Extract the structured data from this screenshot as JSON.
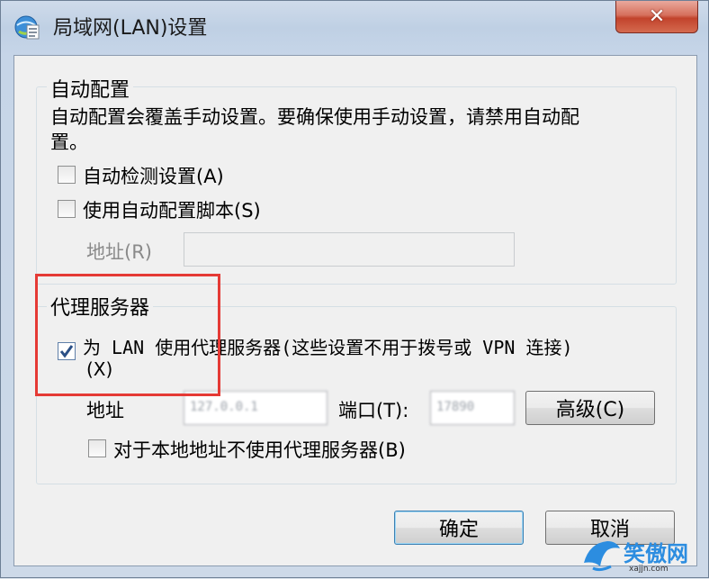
{
  "window": {
    "title": "局域网(LAN)设置",
    "close_label": "✕"
  },
  "auto_config": {
    "group_label": "自动配置",
    "description_line1": "自动配置会覆盖手动设置。要确保使用手动设置，请禁用自动配",
    "description_line2": "置。",
    "auto_detect_label": "自动检测设置(A)",
    "auto_detect_checked": false,
    "use_script_label": "使用自动配置脚本(S)",
    "use_script_checked": false,
    "address_label": "地址(R)",
    "address_value": ""
  },
  "proxy": {
    "group_label": "代理服务器",
    "use_proxy_label_line1": "为 LAN 使用代理服务器(这些设置不用于拨号或 VPN 连接)",
    "use_proxy_label_line2": "(X)",
    "use_proxy_checked": true,
    "address_label": "地址",
    "address_value": "127.0.0.1",
    "port_label": "端口(T):",
    "port_value": "17890",
    "advanced_button": "高级(C)",
    "bypass_local_label": "对于本地地址不使用代理服务器(B)",
    "bypass_local_checked": false
  },
  "buttons": {
    "ok": "确定",
    "cancel": "取消"
  },
  "watermark": {
    "text": "笑傲网",
    "sub": "xajjn.com"
  },
  "colors": {
    "highlight_border": "#e53a35",
    "close_button": "#c2432c",
    "default_button_border": "#3c7fb1"
  }
}
